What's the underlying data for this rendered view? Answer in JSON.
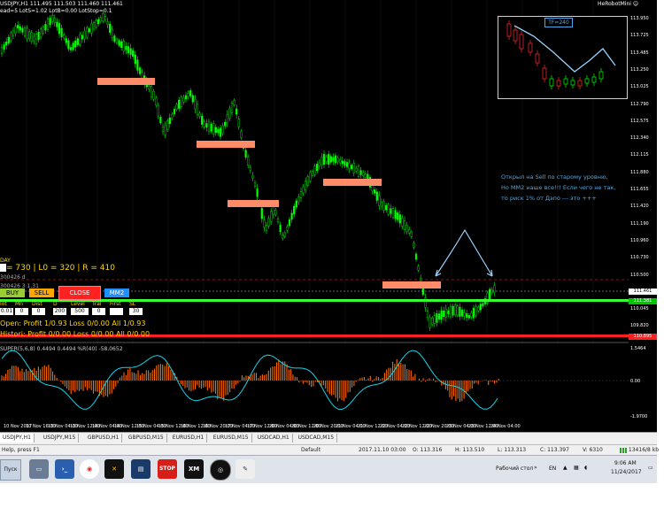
{
  "header": {
    "symbol_line": "USDJPY,H1  111.495 111.503 111.460 111.461",
    "params_line": "ead=5  LotS=1.02  LotB=0.00  LotStop=0.1",
    "mini_label": "HeRobotMini",
    "day_label": "DAY",
    "lro_line": "= 730 | L0 = 320 | R = 410",
    "level_code": "300426 d",
    "lot_code": "300426 3 1.31"
  },
  "controls": {
    "buy": "BUY",
    "sell": "SELL",
    "close": "CLOSE",
    "mm2": "MM2",
    "col_headers": [
      "lot",
      "Mn",
      "Dist",
      "D",
      "Level",
      "Tral",
      "First",
      "SL"
    ],
    "values": [
      "0.01",
      "0",
      "0",
      "200",
      "500",
      "0",
      "",
      "30"
    ],
    "open_line": "Open:  Profit 1/0.93  Loss 0/0.00  All 1/0.93",
    "history_line": "Histori: Profit 0/0.00  Loss 0/0.00  All 0/0.00"
  },
  "note": {
    "text": "Открыл на Sell по старому уровню, Но ММ2 наше все!!! Если чего не так, то риск 1% от Дэпо --- это +++"
  },
  "mini_chart": {
    "tf_label": "TF=240"
  },
  "price_axis": [
    "113.950",
    "113.725",
    "113.485",
    "113.250",
    "113.025",
    "112.790",
    "112.575",
    "112.340",
    "112.115",
    "111.880",
    "111.655",
    "111.420",
    "111.190",
    "110.960",
    "110.730",
    "110.500",
    "110.275",
    "110.045",
    "109.820"
  ],
  "price_tags": {
    "current": "111.461",
    "green": "111.381",
    "red": "110.895"
  },
  "indicator": {
    "label": "SUPER(5,6,8) 0.4494 0.4494 %R(40) -58.0652",
    "axis": [
      "1.5464",
      "0.00",
      "-1.9700"
    ]
  },
  "time_axis": [
    "10 Nov 2017",
    "10 Nov 16:00",
    "13 Nov 04:00",
    "13 Nov 12:00",
    "14 Nov 04:00",
    "14 Nov 12:00",
    "15 Nov 04:00",
    "15 Nov 12:00",
    "16 Nov 12:00",
    "16 Nov 20:00",
    "17 Nov 04:00",
    "17 Nov 12:00",
    "20 Nov 04:00",
    "20 Nov 12:00",
    "20 Nov 20:00",
    "21 Nov 04:00",
    "21 Nov 12:00",
    "22 Nov 04:00",
    "22 Nov 12:00",
    "22 Nov 20:00",
    "23 Nov 04:00",
    "23 Nov 12:00",
    "24 Nov 04:00"
  ],
  "tabs": [
    "USDJPY,H1",
    "USDJPY,M15",
    "GBPUSD,H1",
    "GBPUSD,M15",
    "EURUSD,H1",
    "EURUSD,M15",
    "USDCAD,H1",
    "USDCAD,M15"
  ],
  "status": {
    "help": "Help, press F1",
    "profile": "Default",
    "datetime": "2017.11.10 03:00",
    "open": "O: 113.316",
    "high": "H: 113.510",
    "low": "L: 113.313",
    "close": "C: 113.397",
    "volume": "V: 6310",
    "traffic": "13416/8 kb"
  },
  "taskbar": {
    "start": "Пуск",
    "desktop": "Рабочий стол",
    "lang": "EN",
    "time": "9:06 AM",
    "date": "11/24/2017",
    "stop": "STOP",
    "xm": "XM"
  }
}
